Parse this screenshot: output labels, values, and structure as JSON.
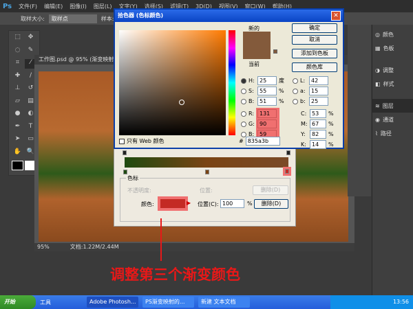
{
  "menubar": {
    "logo": "Ps",
    "items": [
      "文件(F)",
      "编辑(E)",
      "图像(I)",
      "图层(L)",
      "文字(Y)",
      "选择(S)",
      "滤镜(T)",
      "3D(D)",
      "视图(V)",
      "窗口(W)",
      "帮助(H)"
    ]
  },
  "options": {
    "sample_size_label": "取样大小:",
    "sample_size_value": "取样点",
    "sample_label": "样本:"
  },
  "document": {
    "tab": "工作图.psd @ 95% (渐变映射 1...",
    "zoom": "95%",
    "doc_size": "文档:1.22M/2.44M"
  },
  "panels": {
    "items": [
      "颜色",
      "色板",
      "调整",
      "样式",
      "图层",
      "通道",
      "路径"
    ],
    "active": "图层"
  },
  "color_picker": {
    "title": "拾色器 (色标颜色)",
    "new_label": "新的",
    "current_label": "当前",
    "ok": "确定",
    "cancel": "取消",
    "add_swatch": "添加到色板",
    "color_libraries": "颜色库",
    "web_only": "只有 Web 颜色",
    "H": "25",
    "S": "55",
    "B_hsb": "51",
    "R": "131",
    "G": "90",
    "B": "59",
    "L": "42",
    "a": "15",
    "b": "25",
    "C": "53",
    "M": "67",
    "Y": "82",
    "K": "14",
    "hex": "835a3b",
    "deg": "度",
    "pct": "%",
    "new_color": "#835a3b",
    "current_color": "#835a3b"
  },
  "gradient_editor": {
    "group": "色标",
    "opacity_label": "不透明度:",
    "location_label": "位置:",
    "delete_label": "删除(D)",
    "color_label": "颜色:",
    "location_c_label": "位置(C):",
    "location_value": "100",
    "pct": "%",
    "stop_color": "#c42a24"
  },
  "caption": "调整第三个渐变颜色",
  "taskbar": {
    "start": "开始",
    "tools": "工具",
    "tasks": [
      "Adobe Photosh...",
      "PS渐变映射的...",
      "新建 文本文档"
    ],
    "clock": "13:56"
  }
}
